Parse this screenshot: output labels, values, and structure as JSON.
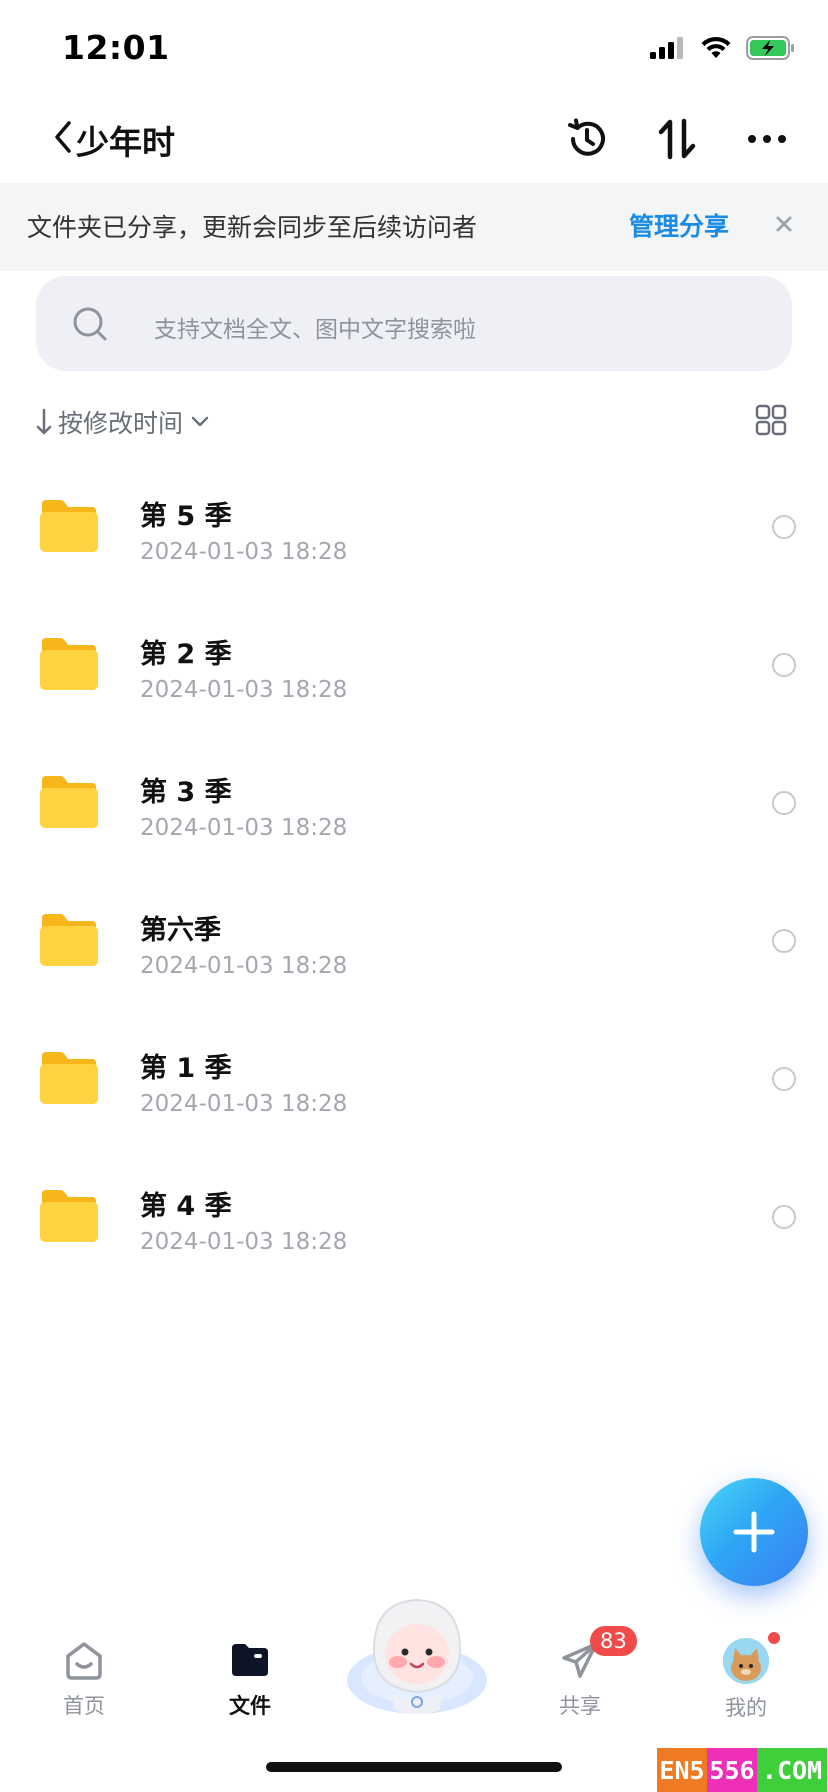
{
  "status_bar": {
    "time": "12:01"
  },
  "nav": {
    "title": "少年时"
  },
  "share_banner": {
    "message": "文件夹已分享，更新会同步至后续访问者",
    "manage_label": "管理分享"
  },
  "search": {
    "placeholder": "支持文档全文、图中文字搜索啦"
  },
  "sort": {
    "label": "按修改时间"
  },
  "files": [
    {
      "name": "第 5 季",
      "date": "2024-01-03 18:28"
    },
    {
      "name": "第 2 季",
      "date": "2024-01-03 18:28"
    },
    {
      "name": "第 3 季",
      "date": "2024-01-03 18:28"
    },
    {
      "name": "第六季",
      "date": "2024-01-03 18:28"
    },
    {
      "name": "第 1 季",
      "date": "2024-01-03 18:28"
    },
    {
      "name": "第 4 季",
      "date": "2024-01-03 18:28"
    }
  ],
  "tabs": [
    {
      "label": "首页",
      "icon": "home-icon",
      "active": false
    },
    {
      "label": "文件",
      "icon": "folder-icon",
      "active": true
    },
    {
      "label": "共享",
      "icon": "send-icon",
      "badge": "83",
      "active": false
    },
    {
      "label": "我的",
      "icon": "avatar",
      "active": false
    }
  ],
  "watermark": {
    "part1": "EN5",
    "part2": "556",
    "part3": ".COM"
  },
  "colors": {
    "accent": "#1a8ce6",
    "folder": "#ffc928",
    "fab": "#2fa6f5",
    "badge": "#f04a4a"
  }
}
